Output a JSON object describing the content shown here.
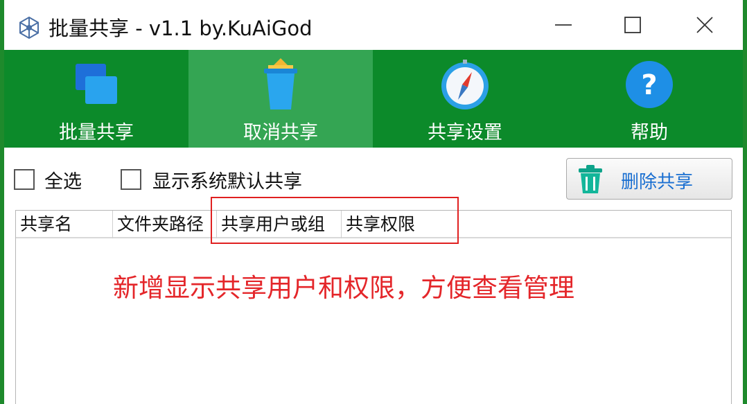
{
  "window": {
    "title": "批量共享 - v1.1 by.KuAiGod"
  },
  "toolbar": {
    "items": [
      {
        "label": "批量共享",
        "icon": "copy-windows-icon"
      },
      {
        "label": "取消共享",
        "icon": "trash-bin-icon"
      },
      {
        "label": "共享设置",
        "icon": "compass-icon"
      },
      {
        "label": "帮助",
        "icon": "help-icon"
      }
    ],
    "active_index": 1
  },
  "options": {
    "select_all_label": "全选",
    "show_system_label": "显示系统默认共享",
    "delete_button_label": "删除共享"
  },
  "list": {
    "columns": [
      "共享名",
      "文件夹路径",
      "共享用户或组",
      "共享权限"
    ]
  },
  "annotation": {
    "text": "新增显示共享用户和权限，方便查看管理"
  },
  "colors": {
    "toolbar_bg": "#0c8a2a",
    "toolbar_active": "#34a553",
    "annotation_red": "#e4262a",
    "button_text_blue": "#1a6fd1"
  }
}
